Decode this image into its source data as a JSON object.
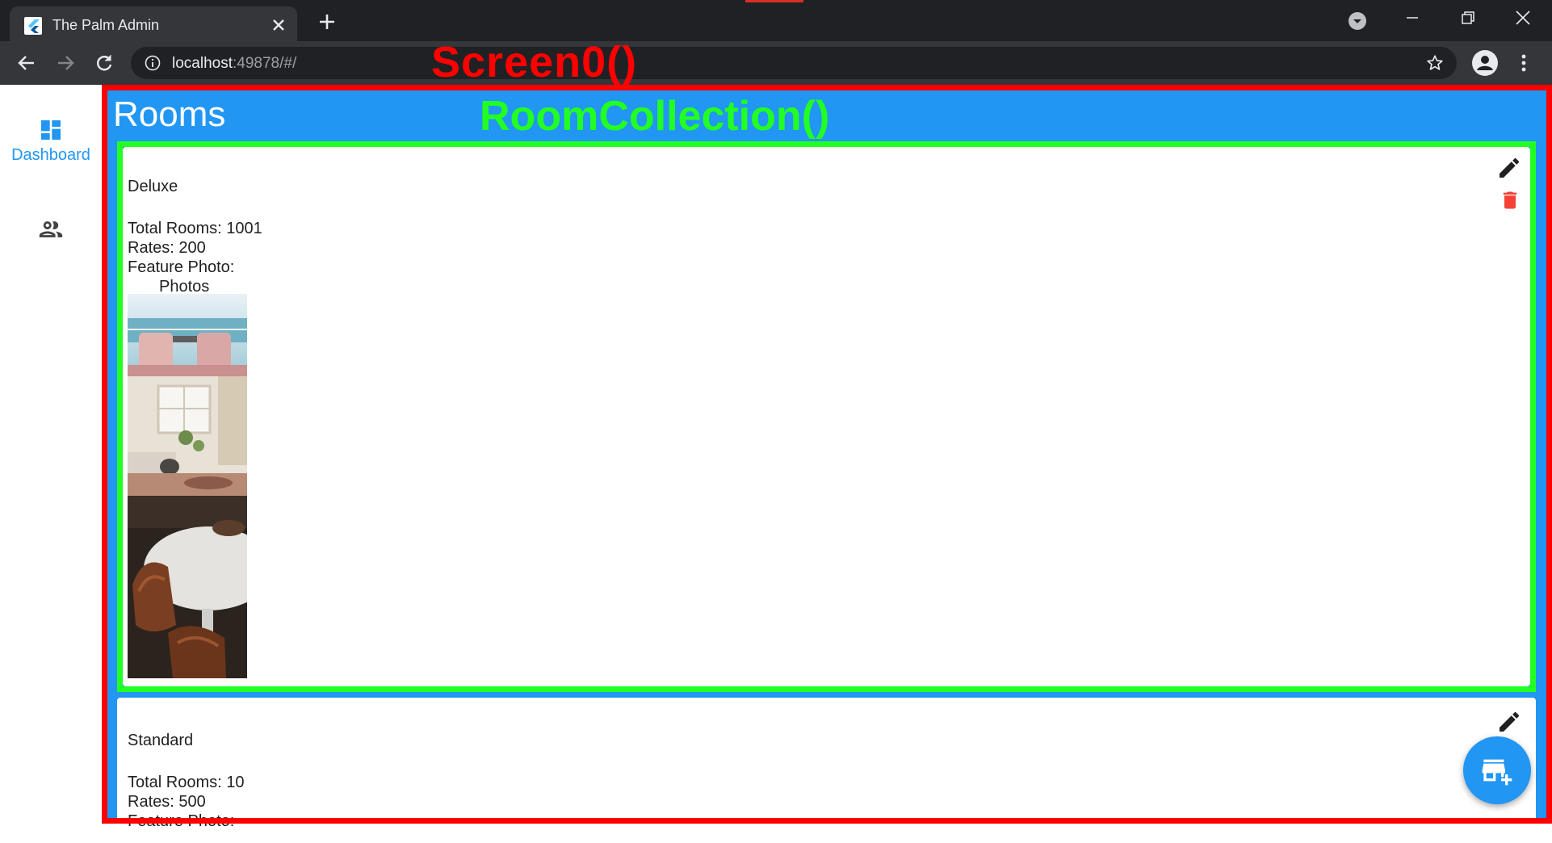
{
  "browser": {
    "tab_title": "The Palm Admin",
    "url_host": "localhost",
    "url_rest": ":49878/#/"
  },
  "overlays": {
    "screen_label": "Screen0()",
    "collection_label": "RoomCollection()",
    "screen_color": "#ff0000",
    "collection_color": "#22ff22"
  },
  "nav": {
    "items": [
      {
        "label": "Dashboard",
        "icon": "dashboard-icon",
        "selected": true
      },
      {
        "label": "",
        "icon": "people-icon",
        "selected": false
      }
    ]
  },
  "page": {
    "title": "Rooms"
  },
  "rooms": [
    {
      "name": "Deluxe",
      "total_rooms": "Total Rooms: 1001",
      "rates": "Rates: 200",
      "feature_photo": "Feature Photo:",
      "photos_label": "Photos"
    },
    {
      "name": "Standard",
      "total_rooms": "Total Rooms: 10",
      "rates": "Rates: 500",
      "feature_photo": "Feature Photo:"
    }
  ],
  "colors": {
    "primary": "#2196f3",
    "delete": "#f44336",
    "chrome_dark": "#202124",
    "chrome_tab": "#35363a"
  }
}
